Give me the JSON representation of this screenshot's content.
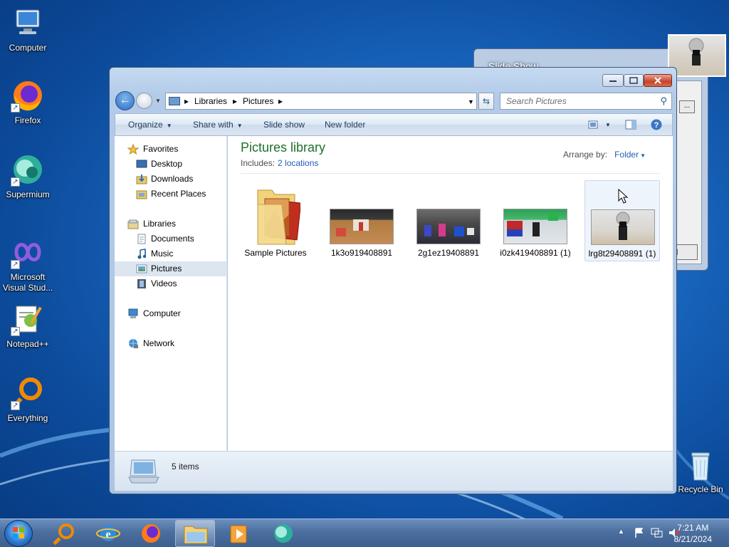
{
  "desktop": {
    "icons": [
      {
        "label": "Computer"
      },
      {
        "label": "Firefox"
      },
      {
        "label": "Supermium"
      },
      {
        "label": "Microsoft Visual Stud..."
      },
      {
        "label": "Notepad++"
      },
      {
        "label": "Everything"
      },
      {
        "label": "Recycle Bin"
      }
    ]
  },
  "slideshow_window": {
    "title": "Slide Show",
    "button_browse": "...",
    "button_cancel": "el"
  },
  "explorer": {
    "address": {
      "crumbs": [
        "Libraries",
        "Pictures"
      ]
    },
    "search_placeholder": "Search Pictures",
    "toolbar": {
      "organize": "Organize",
      "share_with": "Share with",
      "slide_show": "Slide show",
      "new_folder": "New folder"
    },
    "nav": {
      "favorites": "Favorites",
      "desktop": "Desktop",
      "downloads": "Downloads",
      "recent_places": "Recent Places",
      "libraries": "Libraries",
      "documents": "Documents",
      "music": "Music",
      "pictures": "Pictures",
      "videos": "Videos",
      "computer": "Computer",
      "network": "Network"
    },
    "library": {
      "title": "Pictures library",
      "includes_label": "Includes:",
      "includes_link": "2 locations",
      "arrange_label": "Arrange by:",
      "arrange_value": "Folder"
    },
    "items": [
      {
        "name": "Sample Pictures",
        "type": "folder"
      },
      {
        "name": "1k3o919408891",
        "type": "image"
      },
      {
        "name": "2g1ez19408891",
        "type": "image"
      },
      {
        "name": "i0zk419408891 (1)",
        "type": "image"
      },
      {
        "name": "lrg8t29408891 (1)",
        "type": "image",
        "selected": true
      }
    ],
    "status": {
      "count": "5 items"
    }
  },
  "taskbar": {
    "apps": [
      "search-app",
      "internet-explorer",
      "firefox",
      "windows-explorer",
      "media-player",
      "supermium"
    ],
    "active_app": "windows-explorer",
    "clock_time": "7:21 AM",
    "clock_date": "8/21/2024"
  }
}
